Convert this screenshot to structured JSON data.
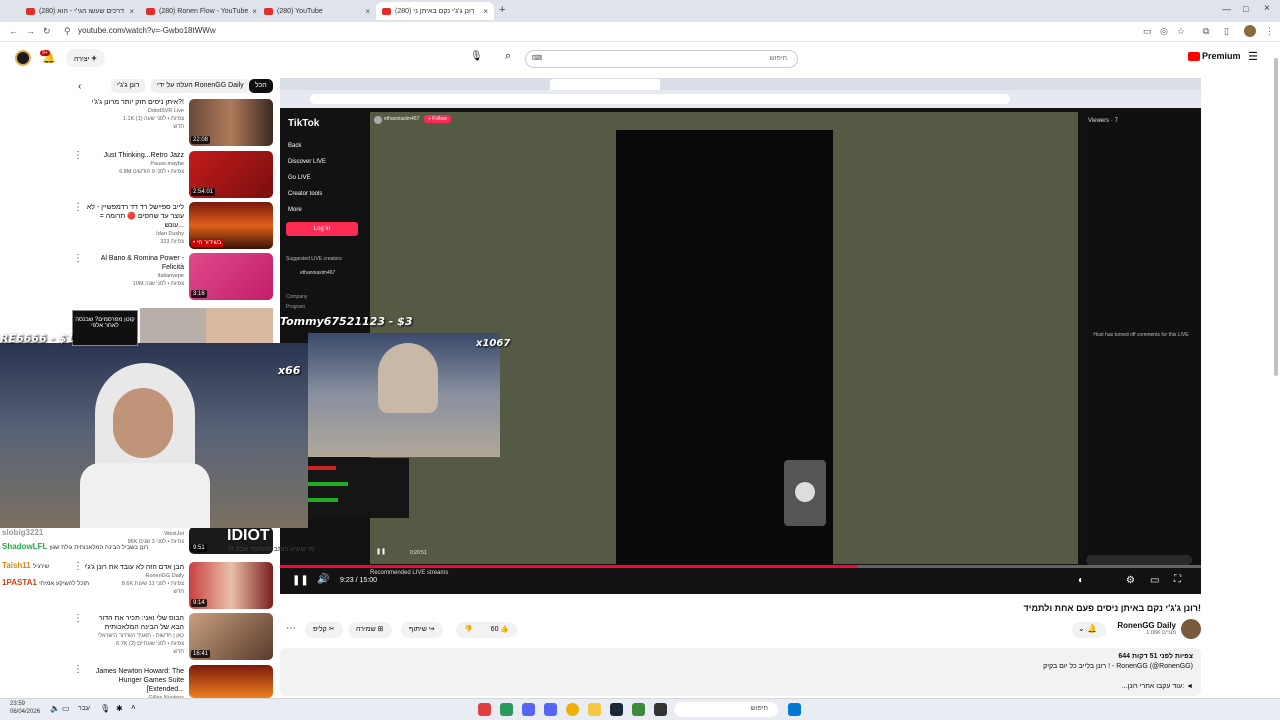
{
  "browser": {
    "tabs": [
      {
        "label": "(280) דרכים שעשו הגי'י - הוא"
      },
      {
        "label": "(280) Ronen Flow - YouTube"
      },
      {
        "label": "(280) YouTube"
      },
      {
        "label": "(280) רונן ג'ג'י נקם באיתן ני"
      }
    ],
    "new_tab": "+",
    "url": "youtube.com/watch?v=-Gwbo18tWWw"
  },
  "yt_header": {
    "premium_label": "Premium",
    "search_placeholder": "חיפוש",
    "create_label": "יצירה",
    "notif_count": "9+"
  },
  "chips": [
    "הכל",
    "העלה על ידי RonenGG Daily",
    "רונן ג'ג'י"
  ],
  "sidebar_videos": [
    {
      "title": "איתן ניסים חזק יותר מרונן ג'ג'י?!",
      "channel": "OdedSVR Live",
      "meta": "1.1K צפיות • לפני שעה (1)",
      "badge": "חדש",
      "duration": "22:08"
    },
    {
      "title": "Just Thinking...Retro Jazz",
      "channel": "Pause.maybe",
      "meta": "6.8M צפיות • לפני 9 חודשים",
      "duration": "2:54:01"
    },
    {
      "title": "לייב ספיישל רד דד רדמפשיין - לא עוצר עד שחסים 🔴 תרומה = עונש...",
      "channel": "Idan Dushy",
      "meta": "323 צפיות",
      "duration": "• בשידור חי"
    },
    {
      "title": "Al Bano & Romina Power - Felicità",
      "channel": "Italianvepe",
      "meta": "10M צפיות • לפני שנה",
      "duration": "3:16"
    },
    {
      "title": "IDIOT",
      "channel": "WestJet",
      "meta": "96K צפיות • לפני 3 שנים",
      "duration": "9:51"
    },
    {
      "title": "הבן אדם הזה לא עובד את רונן ג'ג'י",
      "channel": "RonenGG Daily",
      "meta": "8.6K צפיות • לפני 11 שעות",
      "badge": "חדש",
      "duration": "9:14"
    },
    {
      "title": "הבוס שלי ואני: תכיר את הדור הבא של הבינה המלאכותית",
      "channel": "כאן | חדשות - תאגיד השידור הישראלי",
      "meta": "6.7K צפיות • לפני שעתיים (2)",
      "badge": "חדש",
      "duration": "16:41"
    },
    {
      "title": "James Newton Howard: The Hunger Games Suite [Extended...",
      "channel": "Gilles Nuytens",
      "meta": "",
      "duration": ""
    }
  ],
  "stream_overlays": {
    "donation_top": "Tommy67521123 - $3",
    "multiplier_main": "x1067",
    "multiplier_small": "x66",
    "donation_left": "RE6666 - $1",
    "chat_lines": [
      {
        "user": "slobig3221",
        "text": ""
      },
      {
        "user": "ShadowLFL",
        "text": "רונן בשביל הבינה המלאכותית גולת שגון"
      },
      {
        "user": "Taish11",
        "text": "שירגיל"
      },
      {
        "user": "1PASTA1",
        "text": "תוכל להשיקע אמיתי"
      }
    ],
    "inner_chat_text": "!!! מי שיגיע כותב ההחסר אבל",
    "sticker_text": "קוטן מפרסמים? שבנסה לאחר אלפי"
  },
  "tiktok": {
    "logo": "TikTok",
    "menu": [
      "Back",
      "Discover LIVE",
      "Go LIVE",
      "Creator tools",
      "More"
    ],
    "login": "Log in",
    "suggested": "Suggested LIVE creators",
    "creator": "ethanniaslm467",
    "footer_links": [
      "Company",
      "Program"
    ],
    "follow": "+ Follow",
    "viewers": "Viewers · 7",
    "comments_off": "Host has turned off comments for this LIVE",
    "recommended": "Recommended LIVE streams",
    "inner_time": "0:20:51"
  },
  "player": {
    "time": "9:23 / 15:00",
    "progress": 0.626
  },
  "video": {
    "title": "רונן ג'ג'י נקם באיתן ניסים פעם אחת ולתמיד!",
    "channel": "RonenGG Daily",
    "subs": "1.06K מנויים",
    "likes": "60",
    "share": "שיתוף",
    "save": "שמירה",
    "clip": "קליפ",
    "views_line": "644 צפיות  לפני 51 דקות",
    "desc_line": "רונן בלייב כל יום בקיק ! - RonenGG (@RonenGG)",
    "more": "...עוד",
    "follow_line": "עקבו אחרי רונן:"
  },
  "taskbar": {
    "time": "23:59",
    "date": "06/04/2026",
    "lang": "עבר",
    "search": "חיפוש"
  },
  "colors": {
    "youtube_red": "#ff0000",
    "tiktok_pink": "#fe2c55",
    "progress_red": "#ff0033"
  }
}
